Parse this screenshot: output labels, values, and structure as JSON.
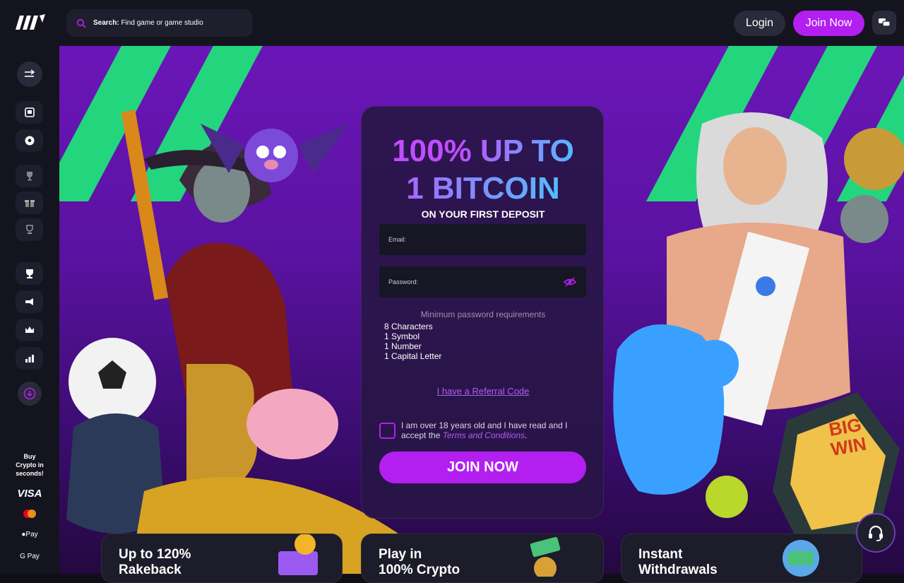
{
  "header": {
    "search_label": "Search:",
    "search_placeholder": "Find game or game studio",
    "login_label": "Login",
    "join_label": "Join Now"
  },
  "sidebar": {
    "items": [
      "expand",
      "slots",
      "sports",
      "tournaments",
      "promotions",
      "vip",
      "trophy",
      "announcements",
      "vip-club",
      "leaderboard",
      "download"
    ],
    "buy_crypto": "Buy Crypto in seconds!",
    "payments": [
      "VISA",
      "Mastercard",
      "Pay",
      "G Pay"
    ]
  },
  "signup": {
    "headline_line1": "100% UP TO",
    "headline_line2": "1 BITCOIN",
    "subheadline": "ON YOUR FIRST DEPOSIT",
    "email_placeholder": "Email:",
    "password_placeholder": "Password:",
    "requirements_title": "Minimum password requirements",
    "requirements": [
      "8 Characters",
      "1 Symbol",
      "1 Number",
      "1 Capital Letter"
    ],
    "referral_link": "I have a Referral Code",
    "terms_prefix": "I am over 18 years old and I have read and I accept the",
    "terms_link": "Terms and Conditions",
    "terms_suffix": ".",
    "cta": "JOIN NOW"
  },
  "features": [
    {
      "line1": "Up to 120%",
      "line2": "Rakeback"
    },
    {
      "line1": "Play in",
      "line2": "100% Crypto"
    },
    {
      "line1": "Instant",
      "line2": "Withdrawals"
    }
  ],
  "promo_badge": {
    "line1": "BIG",
    "line2": "WIN"
  },
  "colors": {
    "accent": "#b21ff0",
    "stripe": "#20e07a",
    "bg": "#14141f"
  }
}
